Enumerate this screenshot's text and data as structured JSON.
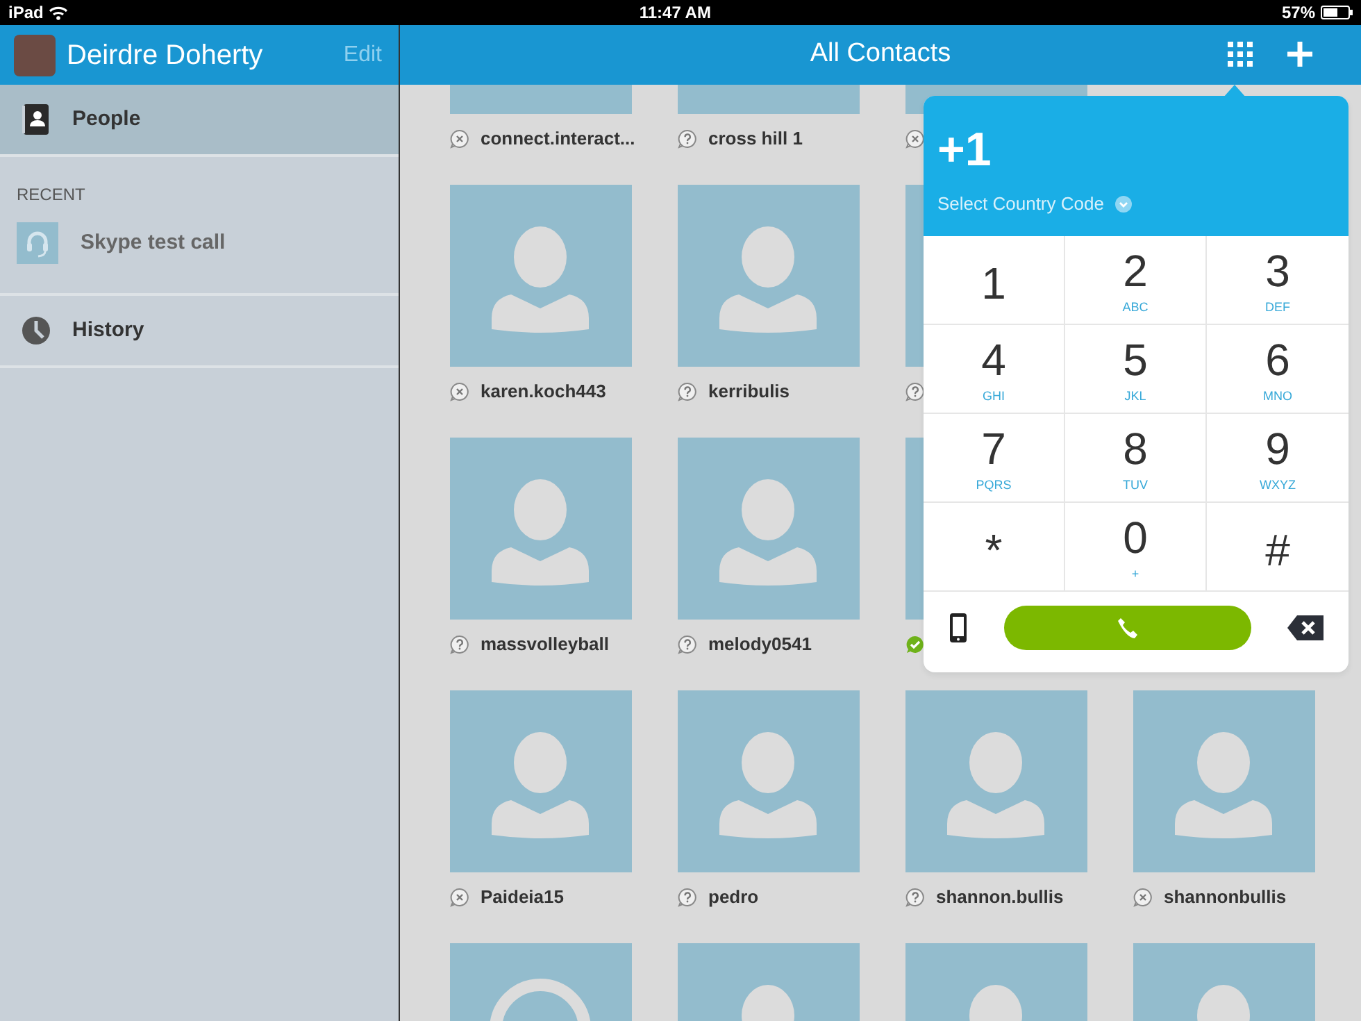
{
  "status_bar": {
    "carrier": "iPad",
    "time": "11:47 AM",
    "battery": "57%"
  },
  "profile": {
    "name": "Deirdre Doherty",
    "edit": "Edit"
  },
  "sidebar": {
    "items": [
      {
        "kind": "people",
        "label": "People",
        "selected": true
      },
      {
        "kind": "heading",
        "label": "RECENT"
      },
      {
        "kind": "recent",
        "label": "Skype test call"
      },
      {
        "kind": "history",
        "label": "History",
        "selected": false
      }
    ]
  },
  "main": {
    "title": "All Contacts"
  },
  "contact_rows": [
    {
      "contacts": [
        {
          "name": "connect.interact...",
          "kind": "offline"
        },
        {
          "name": "cross hill 1",
          "kind": "unknown"
        },
        {
          "kind": "offline"
        }
      ]
    },
    {
      "contacts": [
        {
          "name": "karen.koch443",
          "kind": "offline",
          "custom_avatar": false
        },
        {
          "name": "kerribulis",
          "kind": "unknown",
          "custom_avatar": false
        },
        {
          "kind": "unknown"
        }
      ]
    },
    {
      "contacts": [
        {
          "name": "massvolleyball",
          "kind": "unknown",
          "custom_avatar": false
        },
        {
          "name": "melody0541",
          "kind": "unknown",
          "custom_avatar": false
        },
        {
          "kind": "online"
        }
      ]
    },
    {
      "contacts": [
        {
          "name": "Paideia15",
          "kind": "offline",
          "custom_avatar": false
        },
        {
          "name": "pedro",
          "kind": "unknown",
          "custom_avatar": false
        },
        {
          "name": "shannon.bullis",
          "kind": "unknown",
          "custom_avatar": false
        },
        {
          "name": "shannonbullis",
          "kind": "offline",
          "custom_avatar": false
        }
      ]
    },
    {
      "contacts": [
        {
          "custom_avatar": true
        },
        {
          "custom_avatar": false
        },
        {
          "custom_avatar": false
        },
        {
          "custom_avatar": false
        }
      ]
    }
  ],
  "dialpad": {
    "number": "+1",
    "country_code": "Select Country Code",
    "keys": [
      {
        "digit": "1"
      },
      {
        "digit": "2",
        "letters": "ABC"
      },
      {
        "digit": "3",
        "letters": "DEF"
      },
      {
        "digit": "4",
        "letters": "GHI"
      },
      {
        "digit": "5",
        "letters": "JKL"
      },
      {
        "digit": "6",
        "letters": "MNO"
      },
      {
        "digit": "7",
        "letters": "PQRS"
      },
      {
        "digit": "8",
        "letters": "TUV"
      },
      {
        "digit": "9",
        "letters": "WXYZ"
      },
      {
        "digit": "*"
      },
      {
        "digit": "0",
        "letters": "+"
      },
      {
        "digit": "#"
      }
    ]
  }
}
